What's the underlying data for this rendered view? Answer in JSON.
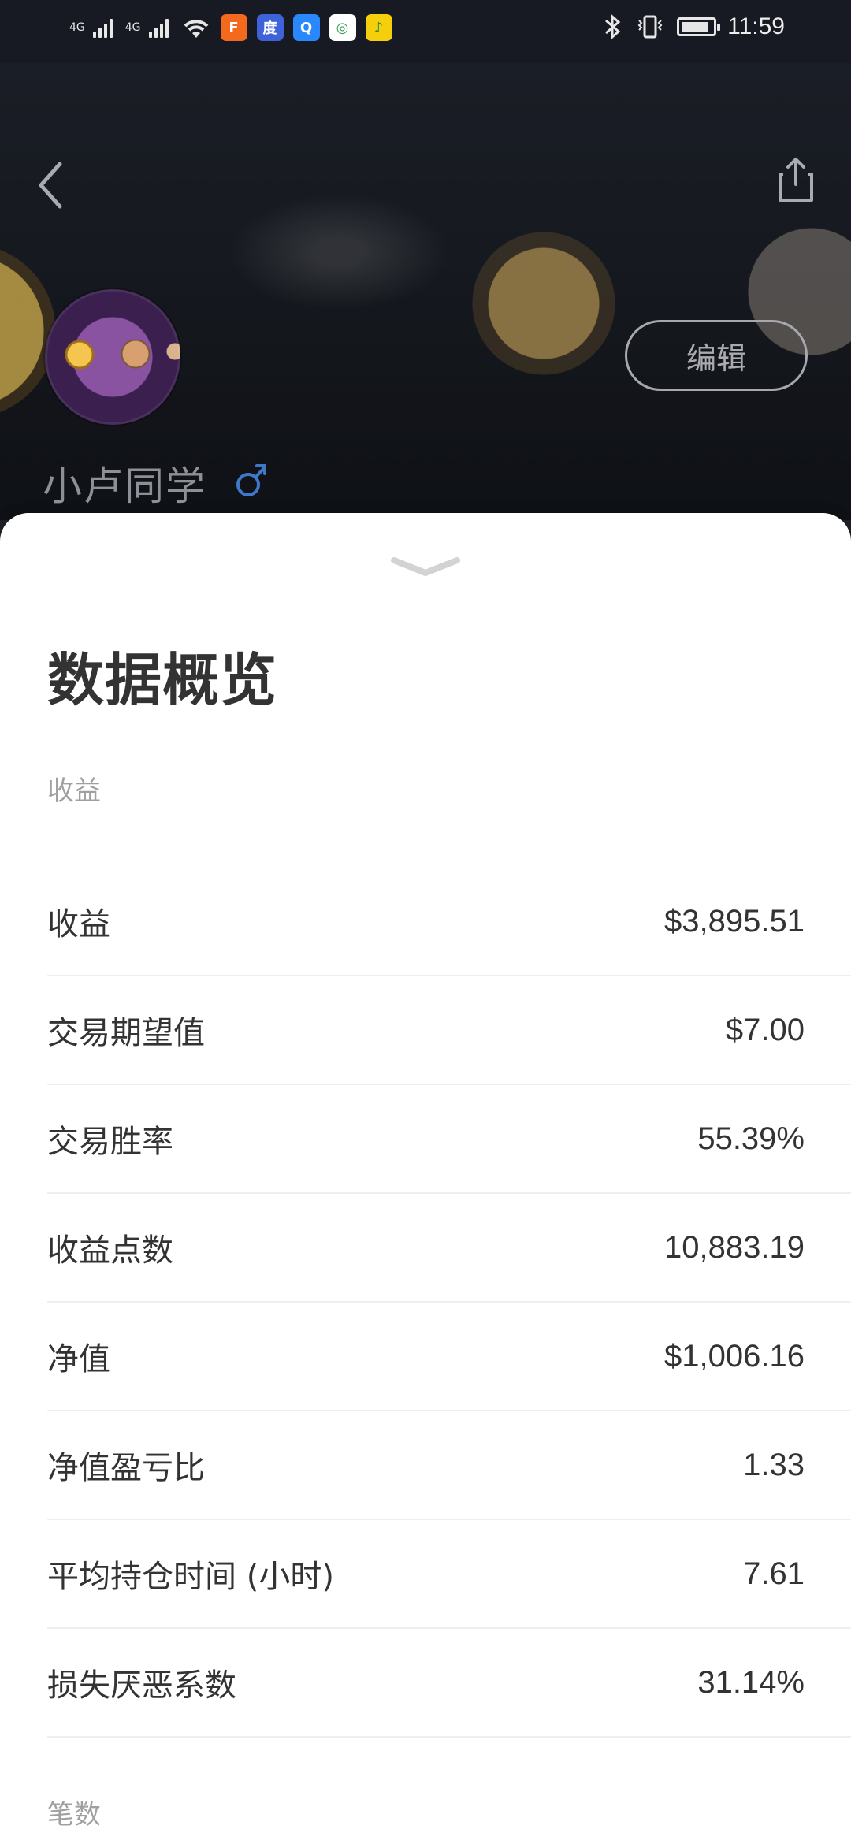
{
  "status_bar": {
    "network_1": "4G",
    "network_2": "4G",
    "time": "11:59",
    "battery_level": 0.9,
    "app_icons": [
      "fire-app-icon",
      "baidu-icon",
      "qq-browser-icon",
      "camera-app-icon",
      "music-app-icon"
    ],
    "colors": {
      "fire-app-icon": "#f36a1f",
      "baidu-icon": "#3e63d8",
      "qq-browser-icon": "#2a88ff",
      "camera-app-icon": "#ffffff",
      "music-app-icon": "#f5cf0b"
    }
  },
  "profile": {
    "edit_label": "编辑",
    "username": "小卢同学",
    "gender": "male-symbol-icon"
  },
  "sheet": {
    "title": "数据概览",
    "section_income": "收益",
    "section_count": "笔数",
    "stats": [
      {
        "label": "收益",
        "value": "$3,895.51"
      },
      {
        "label": "交易期望值",
        "value": "$7.00"
      },
      {
        "label": "交易胜率",
        "value": "55.39%"
      },
      {
        "label": "收益点数",
        "value": "10,883.19"
      },
      {
        "label": "净值",
        "value": "$1,006.16"
      },
      {
        "label": "净值盈亏比",
        "value": "1.33"
      },
      {
        "label": "平均持仓时间 (小时)",
        "value": "7.61"
      },
      {
        "label": "损失厌恶系数",
        "value": "31.14%"
      }
    ]
  },
  "colors": {
    "accent_blue": "#3f78c8",
    "sheet_background": "#ffffff",
    "text_primary": "#333333",
    "text_secondary": "#a0a0a0"
  }
}
